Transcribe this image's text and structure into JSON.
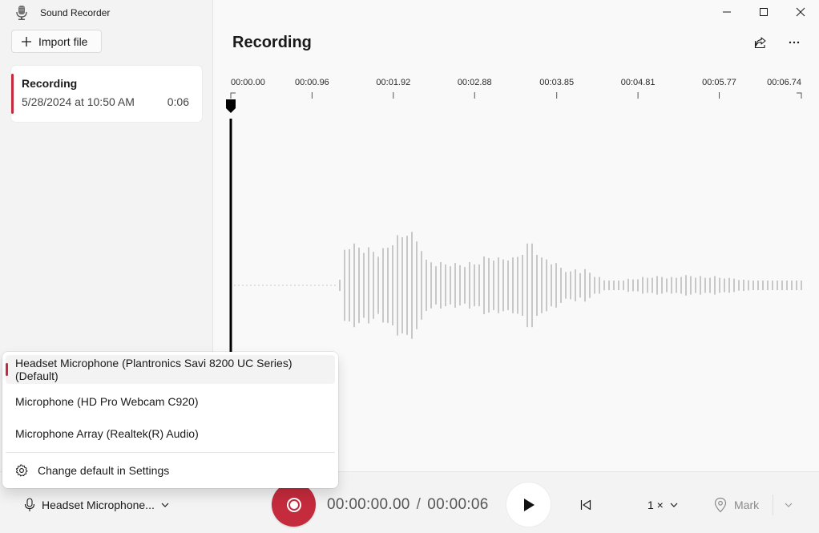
{
  "app": {
    "title": "Sound Recorder"
  },
  "sidebar": {
    "import_label": "Import file",
    "recordings": [
      {
        "title": "Recording",
        "date": "5/28/2024 at 10:50 AM",
        "duration": "0:06"
      }
    ]
  },
  "main": {
    "title": "Recording",
    "timeline": {
      "ticks": [
        {
          "label": "00:00.00",
          "seconds": 0
        },
        {
          "label": "00:00.96",
          "seconds": 0.96
        },
        {
          "label": "00:01.92",
          "seconds": 1.92
        },
        {
          "label": "00:02.88",
          "seconds": 2.88
        },
        {
          "label": "00:03.85",
          "seconds": 3.85
        },
        {
          "label": "00:04.81",
          "seconds": 4.81
        },
        {
          "label": "00:05.77",
          "seconds": 5.77
        },
        {
          "label": "00:06.74",
          "seconds": 6.74
        }
      ],
      "playhead_seconds": 0,
      "total_seconds": 6.74
    }
  },
  "controls": {
    "microphone_label": "Headset Microphone...",
    "current_time": "00:00:00.00",
    "separator": "/",
    "total_time": "00:00:06",
    "speed_label": "1 ×",
    "mark_label": "Mark"
  },
  "mic_menu": {
    "items": [
      {
        "label": "Headset Microphone (Plantronics Savi 8200 UC Series) (Default)",
        "selected": true
      },
      {
        "label": "Microphone (HD Pro Webcam C920)",
        "selected": false
      },
      {
        "label": "Microphone Array (Realtek(R) Audio)",
        "selected": false
      }
    ],
    "settings_label": "Change default in Settings"
  },
  "colors": {
    "accent": "#c42b3c",
    "waveform": "#c8c8c8",
    "playhead": "#000000"
  }
}
